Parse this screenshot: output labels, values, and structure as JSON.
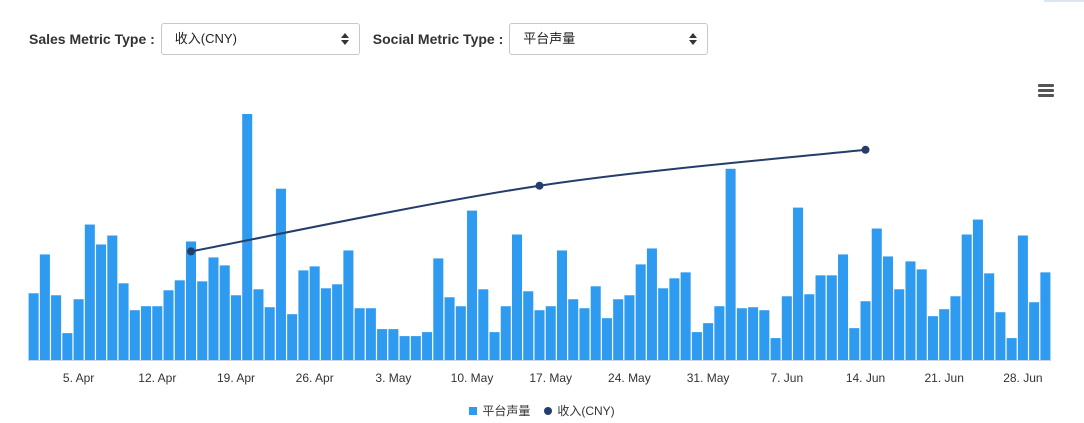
{
  "controls": {
    "sales_label": "Sales Metric Type :",
    "sales_value": "收入(CNY)",
    "social_label": "Social Metric Type :",
    "social_value": "平台声量"
  },
  "menu_icon": "hamburger-menu-icon",
  "colors": {
    "bar": "#2f9bf0",
    "line": "#253d6b"
  },
  "chart_data": {
    "type": "bar+line",
    "title": "",
    "xlabel": "",
    "ylabel": "",
    "x_tick_labels": [
      "5. Apr",
      "12. Apr",
      "19. Apr",
      "26. Apr",
      "3. May",
      "10. May",
      "17. May",
      "24. May",
      "31. May",
      "7. Jun",
      "14. Jun",
      "21. Jun",
      "28. Jun"
    ],
    "x_range": [
      "2017-04-01",
      "2017-06-30"
    ],
    "legend": {
      "placement": "bottom-center",
      "entries": [
        "平台声量",
        "收入(CNY)"
      ]
    },
    "grid": false,
    "series": [
      {
        "name": "平台声量",
        "type": "column",
        "start_date": "2017-04-01",
        "values": [
          67,
          106,
          65,
          27,
          61,
          136,
          116,
          125,
          77,
          50,
          54,
          54,
          70,
          80,
          119,
          79,
          103,
          95,
          65,
          247,
          71,
          53,
          172,
          46,
          90,
          94,
          72,
          76,
          110,
          52,
          52,
          31,
          31,
          24,
          24,
          28,
          102,
          63,
          54,
          150,
          71,
          28,
          54,
          126,
          69,
          50,
          54,
          110,
          61,
          52,
          74,
          42,
          61,
          65,
          96,
          112,
          72,
          82,
          88,
          28,
          37,
          54,
          192,
          52,
          53,
          50,
          22,
          64,
          153,
          66,
          85,
          85,
          106,
          32,
          59,
          132,
          104,
          71,
          99,
          91,
          44,
          51,
          64,
          126,
          141,
          87,
          48,
          22,
          125,
          58,
          88
        ],
        "ylim": [
          0,
          250
        ]
      },
      {
        "name": "收入(CNY)",
        "type": "line",
        "points": [
          [
            "2017-04-15",
            109
          ],
          [
            "2017-05-16",
            175
          ],
          [
            "2017-06-14",
            211
          ]
        ],
        "ylim": [
          0,
          250
        ]
      }
    ]
  }
}
